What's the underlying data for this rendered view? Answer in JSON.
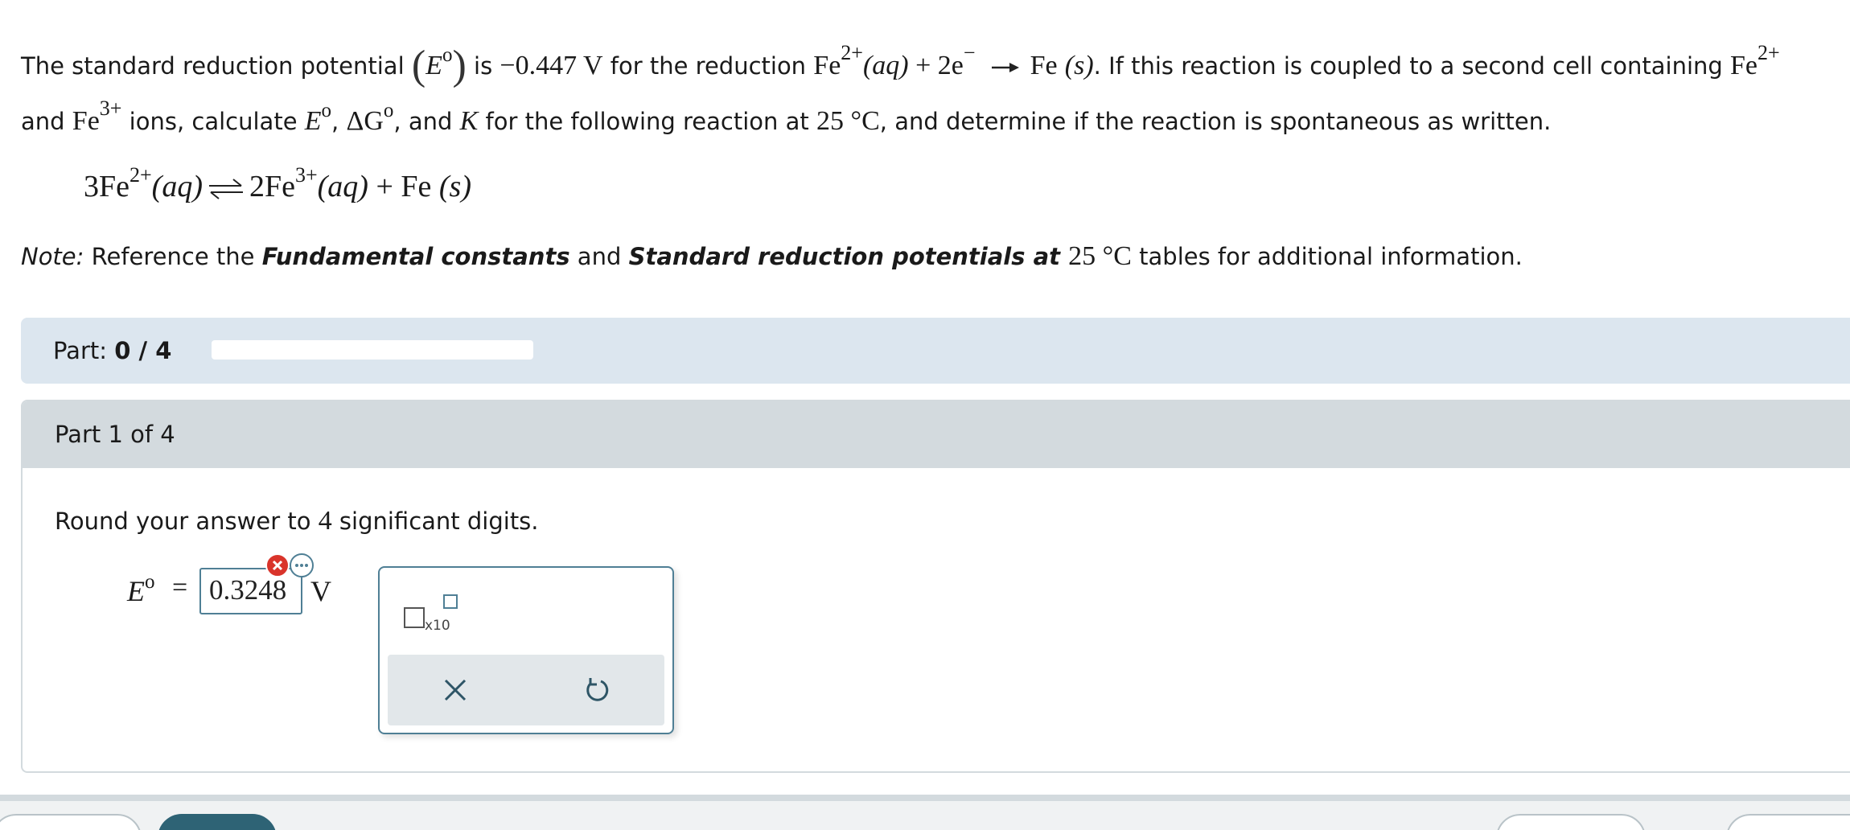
{
  "question": {
    "l1_a": "The standard reduction potential ",
    "l1_E": "E",
    "l1_o": "o",
    "l1_b": " is ",
    "l1_val": "−0.447 V",
    "l1_c": " for the reduction ",
    "l1_fe": "Fe",
    "l1_fe_chg": "2+",
    "l1_aq": "(aq)",
    "l1_plus": " + 2e",
    "l1_e_chg": "−",
    "l1_prod": "Fe",
    "l1_s": "(s)",
    "l1_d": ". If this reaction is coupled to a second cell containing ",
    "l1_fe2": "Fe",
    "l1_fe2_chg": "2+",
    "l2_a": "and ",
    "l2_fe": "Fe",
    "l2_fe_chg": "3+",
    "l2_b": " ions, calculate ",
    "l2_E": "E",
    "l2_o": "o",
    "l2_comma": ", ",
    "l2_dG": "ΔG",
    "l2_o2": "o",
    "l2_c": ", and ",
    "l2_K": "K",
    "l2_d": " for the following reaction at ",
    "l2_temp": "25 °C",
    "l2_e": ", and determine if the reaction is spontaneous as written."
  },
  "reaction": {
    "r1": "3Fe",
    "r1_chg": "2+",
    "r1_state": "(aq)",
    "p1": "2Fe",
    "p1_chg": "3+",
    "p1_state": "(aq)",
    "plus": " + ",
    "p2": "Fe ",
    "p2_state": "(s)"
  },
  "note": {
    "prefix": "Note:",
    "a": " Reference the ",
    "b1": "Fundamental constants",
    "c": " and ",
    "b2": "Standard reduction potentials at ",
    "temp": "25 °C",
    "d": " tables for additional information."
  },
  "part_bar": {
    "label": "Part: ",
    "value": "0 / 4",
    "progress": 0
  },
  "part": {
    "title": "Part 1 of 4",
    "instruction_a": "Round your answer to ",
    "instruction_n": "4",
    "instruction_b": " significant digits.",
    "symbol": "E",
    "symbol_sup": "o",
    "equals": "=",
    "answer_value": "0.3248",
    "unit": "V",
    "answer_status": "incorrect"
  },
  "palette": {
    "sci_label": "x10",
    "icons": [
      "scientific-notation-icon",
      "clear-icon",
      "undo-icon"
    ]
  },
  "colors": {
    "accent": "#4f7f95",
    "error": "#d9342b",
    "part_bar_bg": "#dce6ef",
    "part_head_bg": "#d3dade",
    "action_bg": "#e2e7ea",
    "primary_button": "#2e6375"
  }
}
